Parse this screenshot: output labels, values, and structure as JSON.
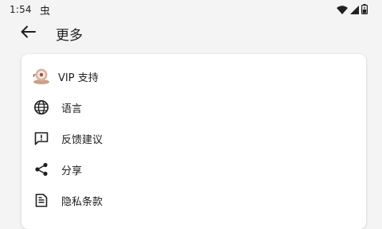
{
  "status_bar": {
    "time": "1:54",
    "notification_glyph": "虫",
    "icons": [
      "wifi-icon",
      "signal-icon",
      "battery-icon"
    ]
  },
  "header": {
    "title": "更多",
    "back_icon": "arrow-left-icon"
  },
  "menu": {
    "items": [
      {
        "label": "VIP 支持",
        "icon": "vip-support-icon"
      },
      {
        "label": "语言",
        "icon": "globe-icon"
      },
      {
        "label": "反馈建议",
        "icon": "feedback-icon"
      },
      {
        "label": "分享",
        "icon": "share-icon"
      },
      {
        "label": "隐私条款",
        "icon": "document-icon"
      }
    ]
  },
  "colors": {
    "background": "#f4f4f4",
    "card": "#ffffff",
    "text": "#202020",
    "vip_accent": "#c9a08a"
  }
}
